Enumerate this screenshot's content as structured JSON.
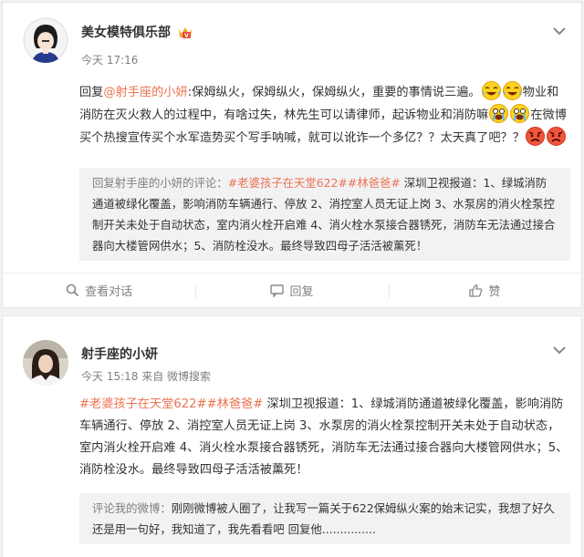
{
  "post1": {
    "username": "美女模特俱乐部",
    "time": "今天 17:16",
    "reply_prefix": "回复",
    "reply_mention": "@射手座的小妍",
    "body_a": ":保姆纵火，保姆纵火，保姆纵火，重要的事情说三遍。",
    "body_b": "物业和消防在灭火救人的过程中，有啥过失，林先生可以请律师，起诉物业和消防嘛",
    "body_c": "在微博买个热搜宣传买个水军造势买个写手呐喊，就可以讹诈一个多亿？？太天真了吧？？",
    "quote_head": "回复射手座的小妍的评论：",
    "quote_tag1": "#老婆孩子在天堂622#",
    "quote_tag2": "#林爸爸#",
    "quote_body": " 深圳卫视报道：1、绿城消防通道被绿化覆盖，影响消防车辆通行、停放 2、消控室人员无证上岗 3、水泵房的消火栓泵控制开关未处于自动状态，室内消火栓开启难 4、消火栓水泵接合器锈死，消防车无法通过接合器向大楼管网供水；5、消防栓没水。最终导致四母子活活被薰死！",
    "actions": {
      "view_dialog": "查看对话",
      "reply": "回复",
      "like": "赞"
    }
  },
  "post2": {
    "username": "射手座的小妍",
    "time": "今天 15:18 来自 微博搜索",
    "tag1": "#老婆孩子在天堂622#",
    "tag2": "#林爸爸#",
    "body": " 深圳卫视报道：1、绿城消防通道被绿化覆盖，影响消防车辆通行、停放 2、消控室人员无证上岗 3、水泵房的消火栓泵控制开关未处于自动状态，室内消火栓开启难 4、消火栓水泵接合器锈死，消防车无法通过接合器向大楼管网供水；5、消防栓没水。最终导致四母子活活被薰死！",
    "quote_head": "评论我的微博：",
    "quote_body": "刚刚微博被人圈了，让我写一篇关于622保姆纵火案的始末记实，我想了好久还是用一句好，我知道了，我先看看吧 回复他..............."
  },
  "icons": {
    "vip_badge": "vip-crown-icon",
    "laugh": "laugh-cry-emoji",
    "cry": "crying-emoji",
    "angry": "angry-emoji"
  },
  "colors": {
    "link": "#eb7350",
    "meta": "#808080",
    "quote_bg": "#f2f2f5"
  }
}
